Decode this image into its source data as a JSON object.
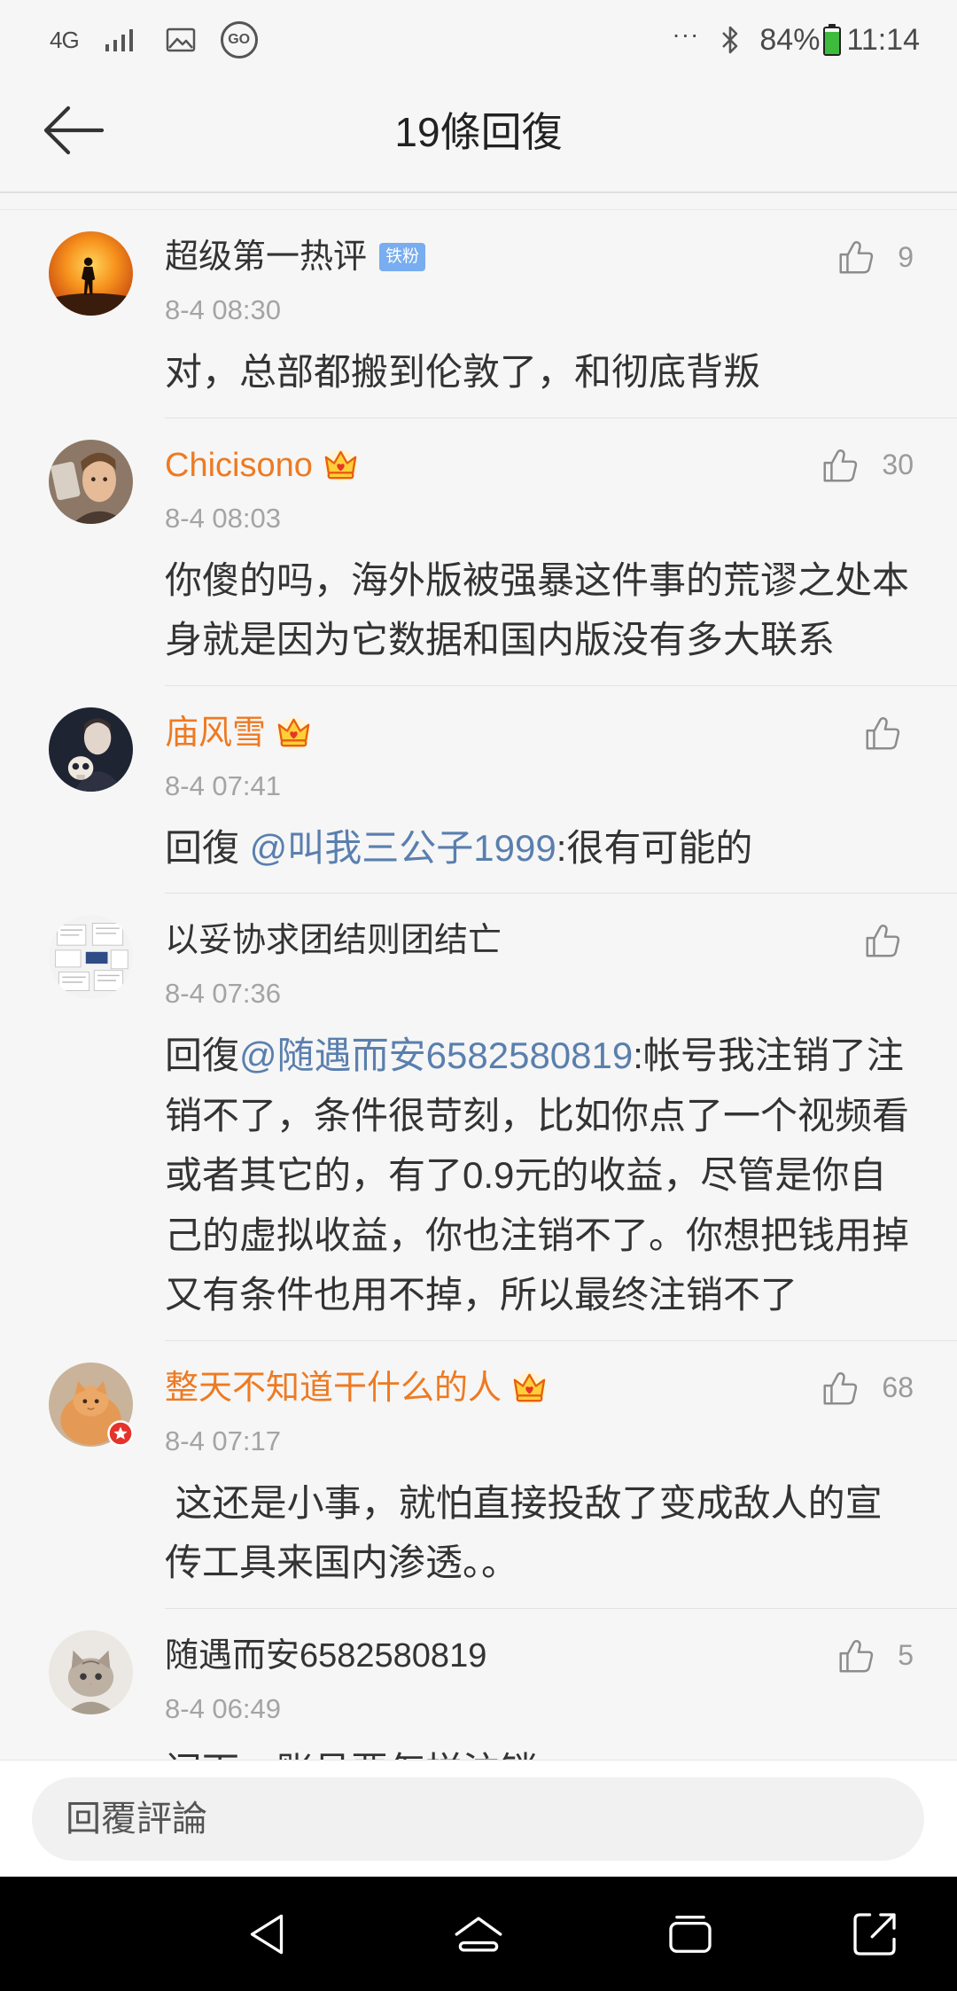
{
  "status_bar": {
    "network": "4G",
    "go_label": "GO",
    "overflow": "···",
    "battery_percent": "84%",
    "time": "11:14",
    "icons": {
      "network": "4g-icon",
      "signal": "signal-icon",
      "gallery": "image-icon",
      "go": "go-icon",
      "bluetooth": "bluetooth-icon",
      "battery": "battery-icon"
    }
  },
  "header": {
    "title": "19條回復",
    "back_icon": "back-arrow-icon"
  },
  "colors": {
    "background": "#f6f6f6",
    "name": "#333333",
    "vip_name": "#ee7a22",
    "mention": "#5a7fae",
    "meta": "#a4a4a4",
    "fan_badge": "#78adf0",
    "battery": "#3dbb3d"
  },
  "comments": [
    {
      "name": "超级第一热评",
      "vip": false,
      "badge": "铁粉",
      "date": "8-4 08:30",
      "likes": "9",
      "text": [
        {
          "t": "对，总部都搬到伦敦了，和彻底背叛"
        }
      ]
    },
    {
      "name": "Chicisono",
      "vip": true,
      "vip_icon": "crown-icon",
      "date": "8-4 08:03",
      "likes": "30",
      "text": [
        {
          "t": "你傻的吗，海外版被强暴这件事的荒谬之处本身就是因为它数据和国内版没有多大联系"
        }
      ]
    },
    {
      "name": "庙风雪",
      "vip": true,
      "vip_icon": "crown-icon",
      "date": "8-4 07:41",
      "text": [
        {
          "t": "回復 "
        },
        {
          "t": "@叫我三公子1999",
          "mention": true
        },
        {
          "t": ":很有可能的"
        }
      ]
    },
    {
      "name": "以妥协求团结则团结亡",
      "vip": false,
      "date": "8-4 07:36",
      "text": [
        {
          "t": "回復"
        },
        {
          "t": "@随遇而安6582580819",
          "mention": true
        },
        {
          "t": ":帐号我注销了注销不了，条件很苛刻，比如你点了一个视频看或者其它的，有了0.9元的收益，尽管是你自己的虚拟收益，你也注销不了。你想把钱用掉又有条件也用不掉，所以最终注销不了"
        }
      ]
    },
    {
      "name": "整天不知道干什么的人",
      "vip": true,
      "vip_icon": "crown-icon",
      "avatar_badge_icon": "star-badge-icon",
      "date": "8-4 07:17",
      "likes": "68",
      "text": [
        {
          "t": " 这还是小事，就怕直接投敌了变成敌人的宣传工具来国内渗透。。"
        }
      ]
    },
    {
      "name": "随遇而安6582580819",
      "vip": false,
      "date": "8-4 06:49",
      "likes": "5",
      "text": [
        {
          "t": "问下，账号要怎样注销"
        }
      ]
    }
  ],
  "reply_bar": {
    "placeholder": "回覆評論"
  },
  "nav_bar": {
    "icons": [
      "back-triangle-icon",
      "home-icon",
      "recents-icon",
      "screen-rotate-icon"
    ]
  }
}
